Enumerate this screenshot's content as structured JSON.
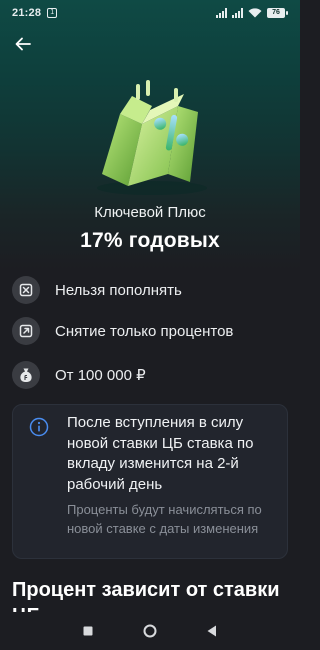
{
  "status_bar": {
    "time": "21:28",
    "sim_badge": "1",
    "battery": "76"
  },
  "header": {
    "back_icon": "arrow-left-icon"
  },
  "deposit": {
    "name": "Ключевой Плюс",
    "rate": "17% годовых",
    "illustration_icon": "percent-calendar-icon"
  },
  "features": [
    {
      "icon": "no-topup-icon",
      "label": "Нельзя пополнять"
    },
    {
      "icon": "withdraw-arrow-icon",
      "label": "Снятие только процентов"
    },
    {
      "icon": "money-bag-icon",
      "label": "От 100 000 ₽"
    }
  ],
  "notice": {
    "icon": "info-icon",
    "main": "После вступления в силу новой ставки ЦБ ставка по вкладу изменится на 2-й рабочий день",
    "sub": "Проценты будут начисляться по новой ставке с даты изменения"
  },
  "section": {
    "title": "Процент зависит от ставки ЦБ"
  },
  "colors": {
    "background": "#1c1d22",
    "hero_top": "#0f4a45",
    "accent_green": "#9fd86a",
    "info_blue": "#4a8df0",
    "muted_text": "#8a8f98"
  }
}
